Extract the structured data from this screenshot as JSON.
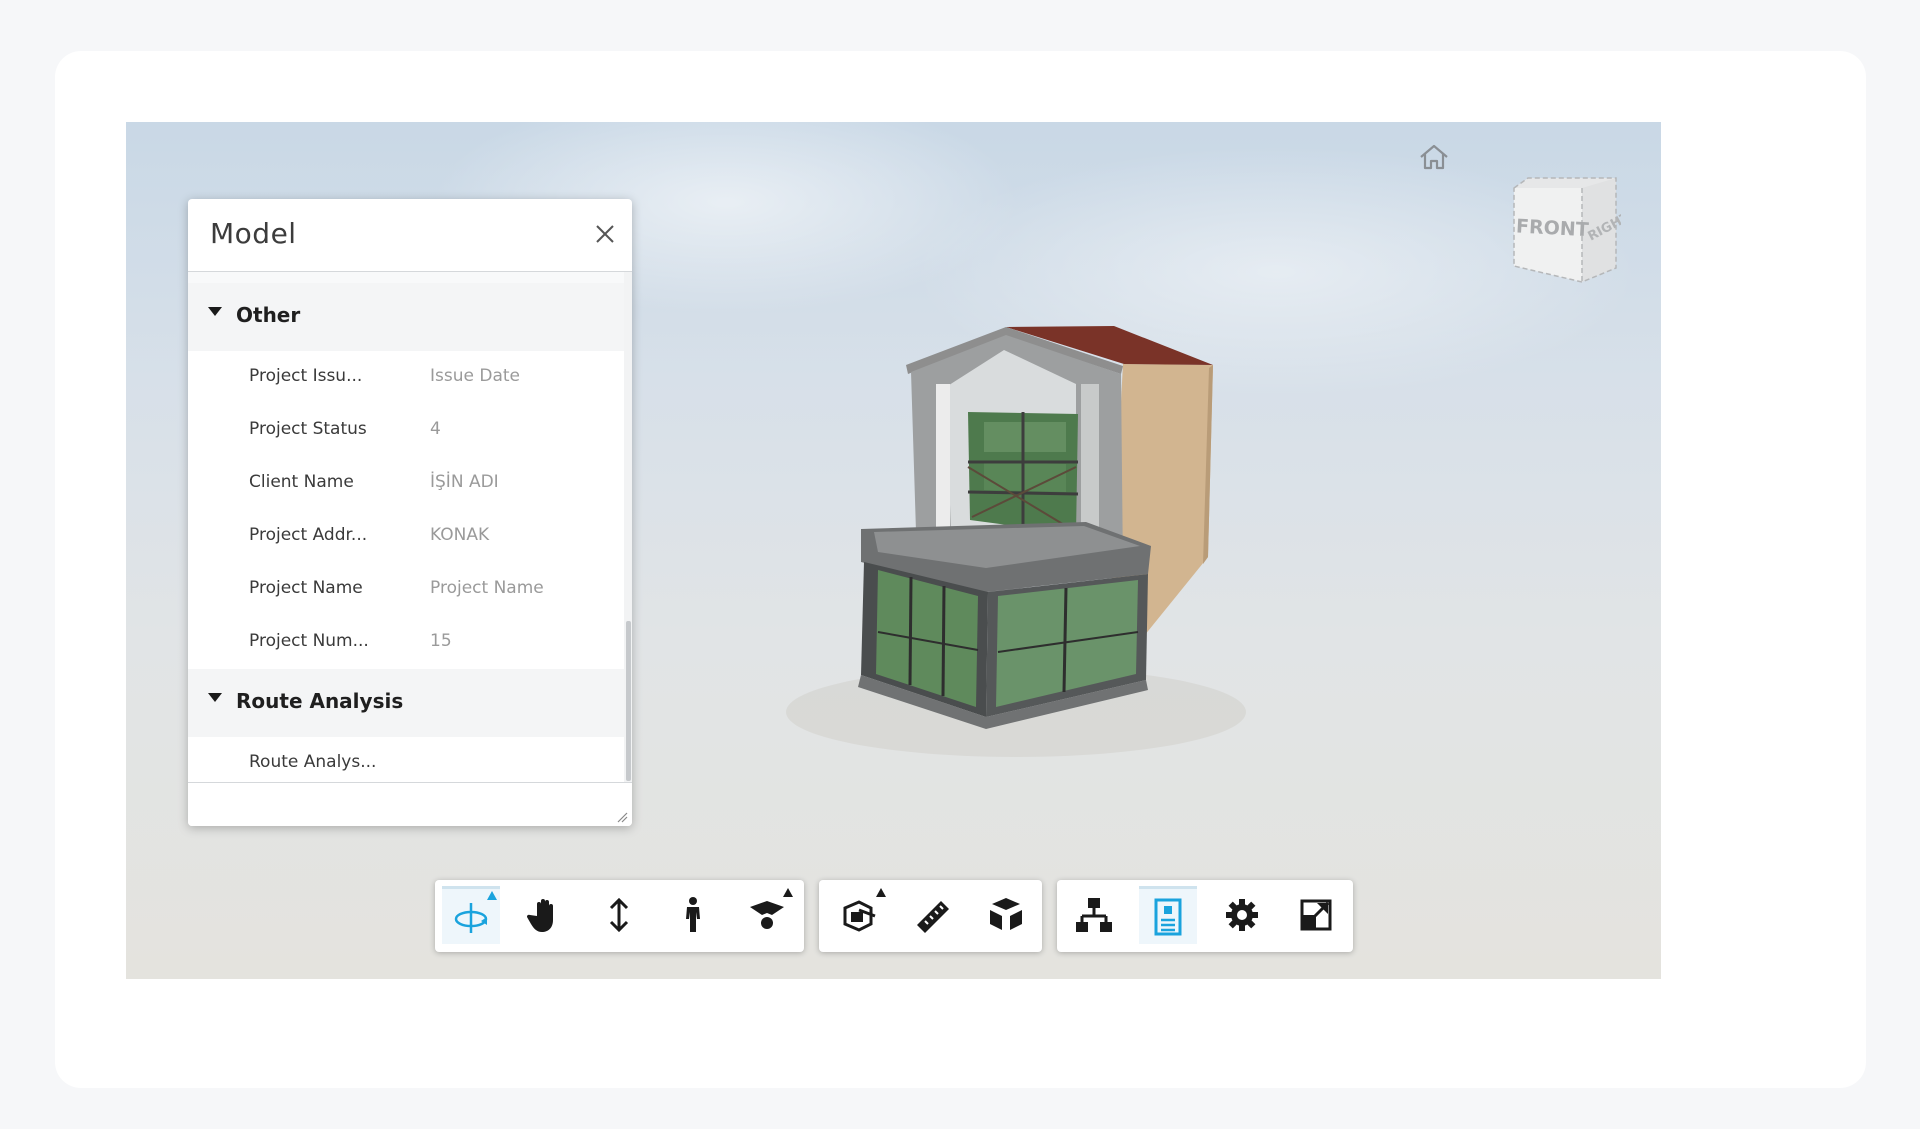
{
  "panel": {
    "title": "Model",
    "groups": [
      {
        "label": "Other",
        "rows": [
          {
            "name": "Project Issu...",
            "value": "Issue Date"
          },
          {
            "name": "Project Status",
            "value": "4"
          },
          {
            "name": "Client Name",
            "value": "İŞİN ADI"
          },
          {
            "name": "Project Addr...",
            "value": "KONAK"
          },
          {
            "name": "Project Name",
            "value": "Project Name"
          },
          {
            "name": "Project Num...",
            "value": "15"
          }
        ]
      },
      {
        "label": "Route Analysis",
        "rows": [
          {
            "name": "Route Analys...",
            "value": ""
          }
        ]
      }
    ]
  },
  "viewcube": {
    "front_label": "FRONT",
    "right_label": "RIGHT"
  },
  "toolbar": {
    "navigation": [
      "orbit-icon",
      "pan-icon",
      "dolly-icon",
      "walk-icon",
      "camera-icon"
    ],
    "modeling": [
      "section-icon",
      "measure-icon",
      "explode-icon"
    ],
    "settings": [
      "model-browser-icon",
      "properties-icon",
      "settings-gear-icon",
      "fullscreen-icon"
    ],
    "active": [
      "orbit-icon",
      "properties-icon"
    ],
    "accent_color": "#1aa3dd"
  }
}
